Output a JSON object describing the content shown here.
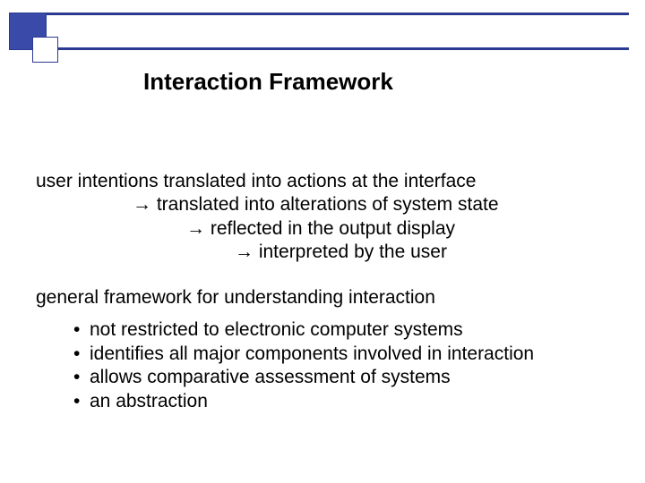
{
  "title": "Interaction Framework",
  "flow": {
    "line1": "user intentions translated into actions at the interface",
    "line2_prefix": "→",
    "line2": " translated into alterations of system state",
    "line3_prefix": "→",
    "line3": " reflected in the output display",
    "line4_prefix": "→",
    "line4": " interpreted by the user"
  },
  "subhead": "general framework for understanding interaction",
  "bullets": [
    "not restricted to electronic computer systems",
    "identifies all major components involved in interaction",
    "allows comparative assessment of systems",
    "an abstraction"
  ],
  "glyphs": {
    "arrow": "→",
    "bullet": "•"
  }
}
